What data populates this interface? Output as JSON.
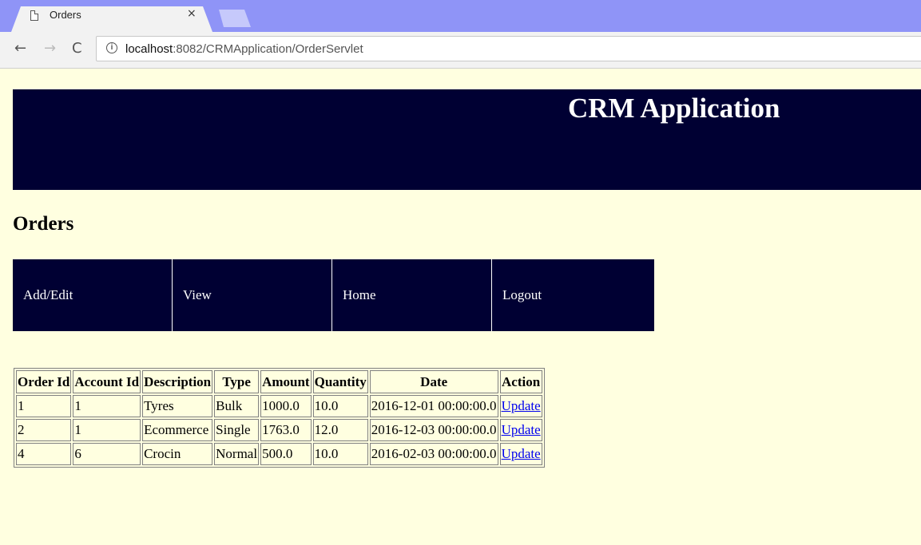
{
  "browser": {
    "tab_title": "Orders",
    "close_glyph": "×",
    "url_host": "localhost",
    "url_rest": ":8082/CRMApplication/OrderServlet",
    "icons": [
      "page-icon",
      "close-icon",
      "back-icon",
      "forward-icon",
      "reload-icon",
      "info-icon"
    ]
  },
  "banner": {
    "title": "CRM Application"
  },
  "page": {
    "heading": "Orders"
  },
  "nav": {
    "items": [
      {
        "label": "Add/Edit"
      },
      {
        "label": "View"
      },
      {
        "label": "Home"
      },
      {
        "label": "Logout"
      }
    ]
  },
  "table": {
    "headers": [
      "Order Id",
      "Account Id",
      "Description",
      "Type",
      "Amount",
      "Quantity",
      "Date",
      "Action"
    ],
    "rows": [
      {
        "order_id": "1",
        "account_id": "1",
        "description": "Tyres",
        "type": "Bulk",
        "amount": "1000.0",
        "quantity": "10.0",
        "date": "2016-12-01 00:00:00.0",
        "action": "Update"
      },
      {
        "order_id": "2",
        "account_id": "1",
        "description": "Ecommerce",
        "type": "Single",
        "amount": "1763.0",
        "quantity": "12.0",
        "date": "2016-12-03 00:00:00.0",
        "action": "Update"
      },
      {
        "order_id": "4",
        "account_id": "6",
        "description": "Crocin",
        "type": "Normal",
        "amount": "500.0",
        "quantity": "10.0",
        "date": "2016-02-03 00:00:00.0",
        "action": "Update"
      }
    ]
  },
  "colors": {
    "page_background": "#ffffe0",
    "banner_background": "#000033",
    "tabstrip": "#8f94f7",
    "link": "#0000ee"
  }
}
